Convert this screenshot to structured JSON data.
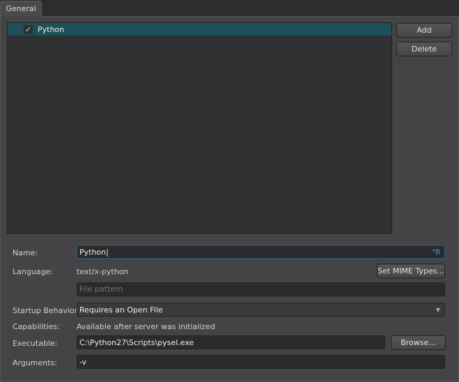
{
  "tab": "General",
  "list": [
    {
      "label": "Python",
      "checked": true
    }
  ],
  "buttons": {
    "add": "Add",
    "delete": "Delete",
    "set_mime": "Set MIME Types...",
    "browse": "Browse..."
  },
  "form": {
    "name_label": "Name:",
    "name_value": "Python",
    "language_label": "Language:",
    "language_value": "text/x-python",
    "file_pattern_placeholder": "File pattern",
    "startup_label": "Startup Behavior:",
    "startup_value": "Requires an Open File",
    "capabilities_label": "Capabilities:",
    "capabilities_value": "Available after server was initialized",
    "executable_label": "Executable:",
    "executable_value": "C:\\Python27\\Scripts\\pysel.exe",
    "arguments_label": "Arguments:",
    "arguments_value": "-v"
  },
  "colors": {
    "selection": "#1d5058",
    "accent": "#3aa0d8"
  }
}
